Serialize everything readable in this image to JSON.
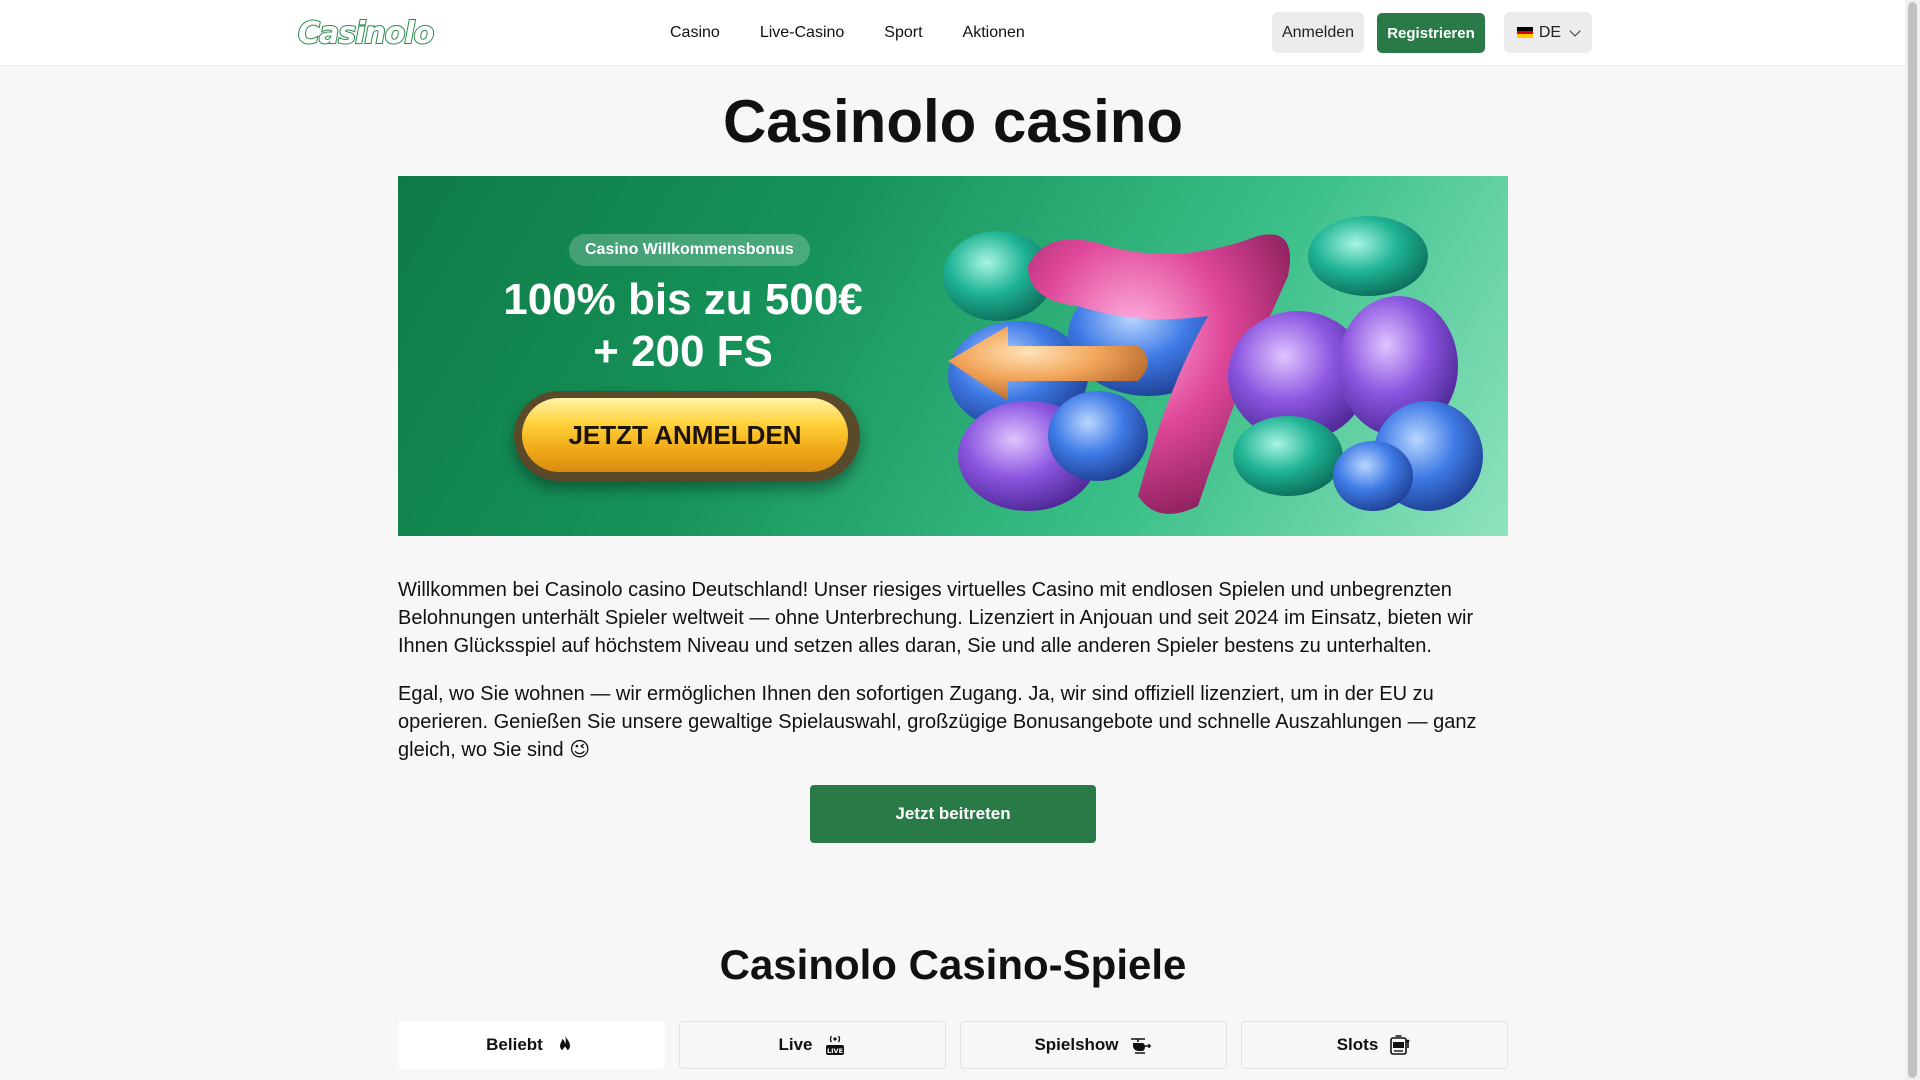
{
  "header": {
    "logo_text": "Casinolo",
    "nav": [
      {
        "label": "Casino"
      },
      {
        "label": "Live-Casino"
      },
      {
        "label": "Sport"
      },
      {
        "label": "Aktionen"
      }
    ],
    "login_label": "Anmelden",
    "register_label": "Registrieren",
    "language": {
      "code": "DE",
      "flag_icon": "germany-flag-icon"
    }
  },
  "page_title": "Casinolo casino",
  "banner": {
    "pill": "Casino Willkommensbonus",
    "line1": "100% bis zu 500€",
    "line2": "+ 200 FS",
    "cta": "JETZT ANMELDEN"
  },
  "intro": {
    "paragraph1": "Willkommen bei Casinolo casino Deutschland! Unser riesiges virtuelles Casino mit endlosen Spielen und unbegrenzten Belohnungen unterhält Spieler weltweit — ohne Unterbrechung. Lizenziert in Anjouan und seit 2024 im Einsatz, bieten wir Ihnen Glücksspiel auf höchstem Niveau und setzen alles daran, Sie und alle anderen Spieler bestens zu unterhalten.",
    "paragraph2": "Egal, wo Sie wohnen — wir ermöglichen Ihnen den sofortigen Zugang. Ja, wir sind offiziell lizenziert, um in der EU zu operieren. Genießen Sie unsere gewaltige Spielauswahl, großzügige Bonusangebote und schnelle Auszahlungen — ganz gleich, wo Sie sind 😉",
    "join_label": "Jetzt beitreten"
  },
  "games": {
    "title": "Casinolo Casino-Spiele",
    "tabs": [
      {
        "label": "Beliebt",
        "icon": "flame-icon",
        "active": true
      },
      {
        "label": "Live",
        "icon": "live-broadcast-icon",
        "active": false
      },
      {
        "label": "Spielshow",
        "icon": "helicopter-icon",
        "active": false
      },
      {
        "label": "Slots",
        "icon": "slot-machine-icon",
        "active": false
      }
    ]
  },
  "colors": {
    "brand_green": "#2a7a48",
    "banner_green": "#16935a",
    "cta_gold": "#ffd23a"
  }
}
